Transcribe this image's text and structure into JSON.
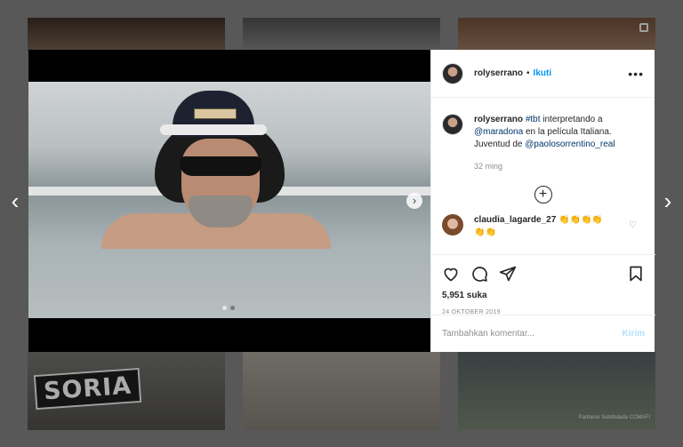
{
  "post": {
    "username": "rolyserrano",
    "follow_label": "Ikuti",
    "bullet": "•",
    "more_label": "•••",
    "caption": {
      "username": "rolyserrano",
      "hashtag": "#tbt",
      "text1": " interpretando a ",
      "mention1": "@maradona",
      "text2": " en la película Italiana. Juventud de ",
      "mention2": "@paolosorrentino_real"
    },
    "time_ago": "32 ming",
    "load_more_label": "+",
    "comments": [
      {
        "username": "claudia_lagarde_27",
        "text": "👏👏👏👏 👏👏"
      }
    ],
    "likes": "5,951 suka",
    "date": "24 OKTOBER 2019",
    "comment_placeholder": "Tambahkan komentar...",
    "send_label": "Kirim"
  },
  "carousel": {
    "slide_count": 2,
    "active_index": 0
  },
  "background": {
    "tile_text": "SORIA",
    "watermark": "Pantanal Subtitulada COMAFI"
  },
  "colors": {
    "link": "#00376b",
    "follow": "#0095f6",
    "send_disabled": "#b2dffc"
  },
  "icons": [
    "chevron-left-icon",
    "chevron-right-icon",
    "heart-icon",
    "comment-icon",
    "share-icon",
    "bookmark-icon",
    "more-icon",
    "multi-photo-icon"
  ]
}
